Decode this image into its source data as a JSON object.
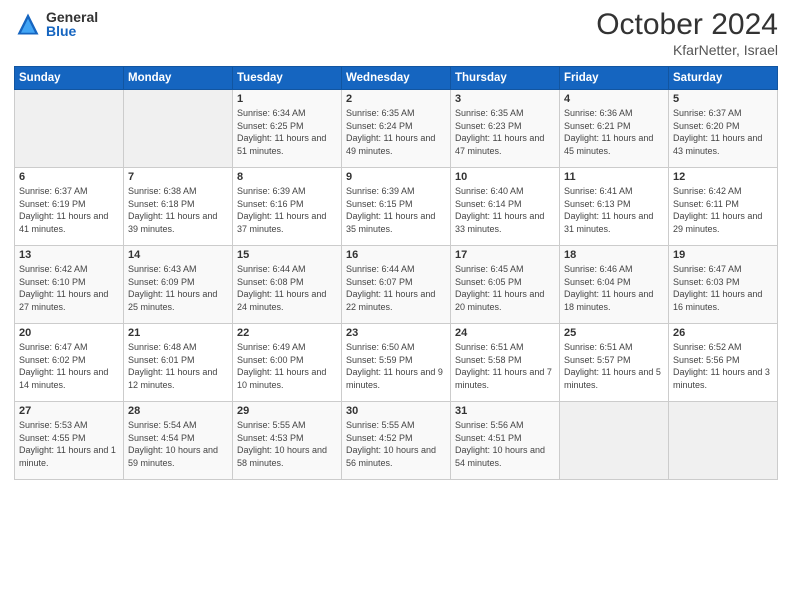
{
  "logo": {
    "general": "General",
    "blue": "Blue"
  },
  "title": "October 2024",
  "location": "KfarNetter, Israel",
  "weekdays": [
    "Sunday",
    "Monday",
    "Tuesday",
    "Wednesday",
    "Thursday",
    "Friday",
    "Saturday"
  ],
  "weeks": [
    [
      {
        "day": "",
        "sunrise": "",
        "sunset": "",
        "daylight": ""
      },
      {
        "day": "",
        "sunrise": "",
        "sunset": "",
        "daylight": ""
      },
      {
        "day": "1",
        "sunrise": "Sunrise: 6:34 AM",
        "sunset": "Sunset: 6:25 PM",
        "daylight": "Daylight: 11 hours and 51 minutes."
      },
      {
        "day": "2",
        "sunrise": "Sunrise: 6:35 AM",
        "sunset": "Sunset: 6:24 PM",
        "daylight": "Daylight: 11 hours and 49 minutes."
      },
      {
        "day": "3",
        "sunrise": "Sunrise: 6:35 AM",
        "sunset": "Sunset: 6:23 PM",
        "daylight": "Daylight: 11 hours and 47 minutes."
      },
      {
        "day": "4",
        "sunrise": "Sunrise: 6:36 AM",
        "sunset": "Sunset: 6:21 PM",
        "daylight": "Daylight: 11 hours and 45 minutes."
      },
      {
        "day": "5",
        "sunrise": "Sunrise: 6:37 AM",
        "sunset": "Sunset: 6:20 PM",
        "daylight": "Daylight: 11 hours and 43 minutes."
      }
    ],
    [
      {
        "day": "6",
        "sunrise": "Sunrise: 6:37 AM",
        "sunset": "Sunset: 6:19 PM",
        "daylight": "Daylight: 11 hours and 41 minutes."
      },
      {
        "day": "7",
        "sunrise": "Sunrise: 6:38 AM",
        "sunset": "Sunset: 6:18 PM",
        "daylight": "Daylight: 11 hours and 39 minutes."
      },
      {
        "day": "8",
        "sunrise": "Sunrise: 6:39 AM",
        "sunset": "Sunset: 6:16 PM",
        "daylight": "Daylight: 11 hours and 37 minutes."
      },
      {
        "day": "9",
        "sunrise": "Sunrise: 6:39 AM",
        "sunset": "Sunset: 6:15 PM",
        "daylight": "Daylight: 11 hours and 35 minutes."
      },
      {
        "day": "10",
        "sunrise": "Sunrise: 6:40 AM",
        "sunset": "Sunset: 6:14 PM",
        "daylight": "Daylight: 11 hours and 33 minutes."
      },
      {
        "day": "11",
        "sunrise": "Sunrise: 6:41 AM",
        "sunset": "Sunset: 6:13 PM",
        "daylight": "Daylight: 11 hours and 31 minutes."
      },
      {
        "day": "12",
        "sunrise": "Sunrise: 6:42 AM",
        "sunset": "Sunset: 6:11 PM",
        "daylight": "Daylight: 11 hours and 29 minutes."
      }
    ],
    [
      {
        "day": "13",
        "sunrise": "Sunrise: 6:42 AM",
        "sunset": "Sunset: 6:10 PM",
        "daylight": "Daylight: 11 hours and 27 minutes."
      },
      {
        "day": "14",
        "sunrise": "Sunrise: 6:43 AM",
        "sunset": "Sunset: 6:09 PM",
        "daylight": "Daylight: 11 hours and 25 minutes."
      },
      {
        "day": "15",
        "sunrise": "Sunrise: 6:44 AM",
        "sunset": "Sunset: 6:08 PM",
        "daylight": "Daylight: 11 hours and 24 minutes."
      },
      {
        "day": "16",
        "sunrise": "Sunrise: 6:44 AM",
        "sunset": "Sunset: 6:07 PM",
        "daylight": "Daylight: 11 hours and 22 minutes."
      },
      {
        "day": "17",
        "sunrise": "Sunrise: 6:45 AM",
        "sunset": "Sunset: 6:05 PM",
        "daylight": "Daylight: 11 hours and 20 minutes."
      },
      {
        "day": "18",
        "sunrise": "Sunrise: 6:46 AM",
        "sunset": "Sunset: 6:04 PM",
        "daylight": "Daylight: 11 hours and 18 minutes."
      },
      {
        "day": "19",
        "sunrise": "Sunrise: 6:47 AM",
        "sunset": "Sunset: 6:03 PM",
        "daylight": "Daylight: 11 hours and 16 minutes."
      }
    ],
    [
      {
        "day": "20",
        "sunrise": "Sunrise: 6:47 AM",
        "sunset": "Sunset: 6:02 PM",
        "daylight": "Daylight: 11 hours and 14 minutes."
      },
      {
        "day": "21",
        "sunrise": "Sunrise: 6:48 AM",
        "sunset": "Sunset: 6:01 PM",
        "daylight": "Daylight: 11 hours and 12 minutes."
      },
      {
        "day": "22",
        "sunrise": "Sunrise: 6:49 AM",
        "sunset": "Sunset: 6:00 PM",
        "daylight": "Daylight: 11 hours and 10 minutes."
      },
      {
        "day": "23",
        "sunrise": "Sunrise: 6:50 AM",
        "sunset": "Sunset: 5:59 PM",
        "daylight": "Daylight: 11 hours and 9 minutes."
      },
      {
        "day": "24",
        "sunrise": "Sunrise: 6:51 AM",
        "sunset": "Sunset: 5:58 PM",
        "daylight": "Daylight: 11 hours and 7 minutes."
      },
      {
        "day": "25",
        "sunrise": "Sunrise: 6:51 AM",
        "sunset": "Sunset: 5:57 PM",
        "daylight": "Daylight: 11 hours and 5 minutes."
      },
      {
        "day": "26",
        "sunrise": "Sunrise: 6:52 AM",
        "sunset": "Sunset: 5:56 PM",
        "daylight": "Daylight: 11 hours and 3 minutes."
      }
    ],
    [
      {
        "day": "27",
        "sunrise": "Sunrise: 5:53 AM",
        "sunset": "Sunset: 4:55 PM",
        "daylight": "Daylight: 11 hours and 1 minute."
      },
      {
        "day": "28",
        "sunrise": "Sunrise: 5:54 AM",
        "sunset": "Sunset: 4:54 PM",
        "daylight": "Daylight: 10 hours and 59 minutes."
      },
      {
        "day": "29",
        "sunrise": "Sunrise: 5:55 AM",
        "sunset": "Sunset: 4:53 PM",
        "daylight": "Daylight: 10 hours and 58 minutes."
      },
      {
        "day": "30",
        "sunrise": "Sunrise: 5:55 AM",
        "sunset": "Sunset: 4:52 PM",
        "daylight": "Daylight: 10 hours and 56 minutes."
      },
      {
        "day": "31",
        "sunrise": "Sunrise: 5:56 AM",
        "sunset": "Sunset: 4:51 PM",
        "daylight": "Daylight: 10 hours and 54 minutes."
      },
      {
        "day": "",
        "sunrise": "",
        "sunset": "",
        "daylight": ""
      },
      {
        "day": "",
        "sunrise": "",
        "sunset": "",
        "daylight": ""
      }
    ]
  ]
}
